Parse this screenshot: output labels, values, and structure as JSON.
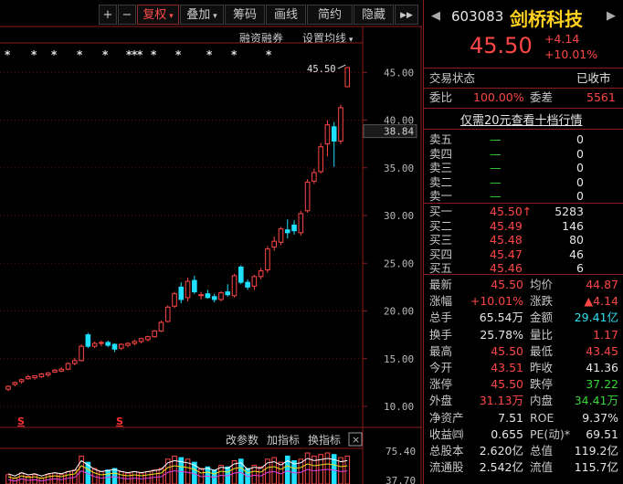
{
  "toolbar": {
    "plus": "+",
    "minus": "−",
    "restore_rights": "复权",
    "overlay": "叠加",
    "chips": "筹码",
    "draw_line": "画线",
    "simple": "简约",
    "hide": "隐藏",
    "forward": "▶▶"
  },
  "subbar": {
    "margin_trading": "融资融券",
    "set_ma": "设置均线"
  },
  "price_axis": [
    "45.00",
    "40.00",
    "35.00",
    "30.00",
    "25.00",
    "20.00",
    "15.00",
    "10.00"
  ],
  "current_price_tag": "38.84",
  "max_label": "45.50",
  "bottom_bar": {
    "change_params": "改参数",
    "add_indicator": "加指标",
    "switch_indicator": "换指标"
  },
  "volume_axis": [
    "75.40",
    "37.70"
  ],
  "s_marker": "S",
  "star_marker": "*",
  "stock": {
    "code": "603083",
    "name": "剑桥科技",
    "price": "45.50",
    "change": "+4.14",
    "pct": "+10.01%"
  },
  "status": {
    "label": "交易状态",
    "value": "已收市"
  },
  "ratio": {
    "label1": "委比",
    "value1": "100.00%",
    "label2": "委差",
    "value2": "5561"
  },
  "banner": "仅需20元查看十档行情",
  "sells": [
    {
      "label": "卖五",
      "price": "—",
      "vol": "0"
    },
    {
      "label": "卖四",
      "price": "—",
      "vol": "0"
    },
    {
      "label": "卖三",
      "price": "—",
      "vol": "0"
    },
    {
      "label": "卖二",
      "price": "—",
      "vol": "0"
    },
    {
      "label": "卖一",
      "price": "—",
      "vol": "0"
    }
  ],
  "buys": [
    {
      "label": "买一",
      "price": "45.50↑",
      "vol": "5283"
    },
    {
      "label": "买二",
      "price": "45.49",
      "vol": "146"
    },
    {
      "label": "买三",
      "price": "45.48",
      "vol": "80"
    },
    {
      "label": "买四",
      "price": "45.47",
      "vol": "46"
    },
    {
      "label": "买五",
      "price": "45.46",
      "vol": "6"
    }
  ],
  "stats": [
    {
      "l1": "最新",
      "v1": "45.50",
      "c1": "red",
      "l2": "均价",
      "v2": "44.87",
      "c2": "red"
    },
    {
      "l1": "涨幅",
      "v1": "+10.01%",
      "c1": "red",
      "l2": "涨跌",
      "v2": "▲4.14",
      "c2": "red"
    },
    {
      "l1": "总手",
      "v1": "65.54万",
      "c1": "white",
      "l2": "金额",
      "v2": "29.41亿",
      "c2": "cyan"
    },
    {
      "l1": "换手",
      "v1": "25.78%",
      "c1": "white",
      "l2": "量比",
      "v2": "1.17",
      "c2": "red"
    },
    {
      "l1": "最高",
      "v1": "45.50",
      "c1": "red",
      "l2": "最低",
      "v2": "43.45",
      "c2": "red"
    },
    {
      "l1": "今开",
      "v1": "43.51",
      "c1": "red",
      "l2": "昨收",
      "v2": "41.36",
      "c2": "white"
    },
    {
      "l1": "涨停",
      "v1": "45.50",
      "c1": "red",
      "l2": "跌停",
      "v2": "37.22",
      "c2": "green"
    },
    {
      "l1": "外盘",
      "v1": "31.13万",
      "c1": "red",
      "l2": "内盘",
      "v2": "34.41万",
      "c2": "green"
    },
    {
      "l1": "净资产",
      "v1": "7.51",
      "c1": "white",
      "l2": "ROE",
      "v2": "9.37%",
      "c2": "white"
    },
    {
      "l1": "收益㈣",
      "v1": "0.655",
      "c1": "white",
      "l2": "PE(动)*",
      "v2": "69.51",
      "c2": "white"
    },
    {
      "l1": "总股本",
      "v1": "2.620亿",
      "c1": "white",
      "l2": "总值",
      "v2": "119.2亿",
      "c2": "white"
    },
    {
      "l1": "流通股",
      "v1": "2.542亿",
      "c1": "white",
      "l2": "流值",
      "v2": "115.7亿",
      "c2": "white"
    }
  ],
  "colors": {
    "up": "#ff4646",
    "down": "#20e0ff",
    "border": "#8a1c1c"
  }
}
